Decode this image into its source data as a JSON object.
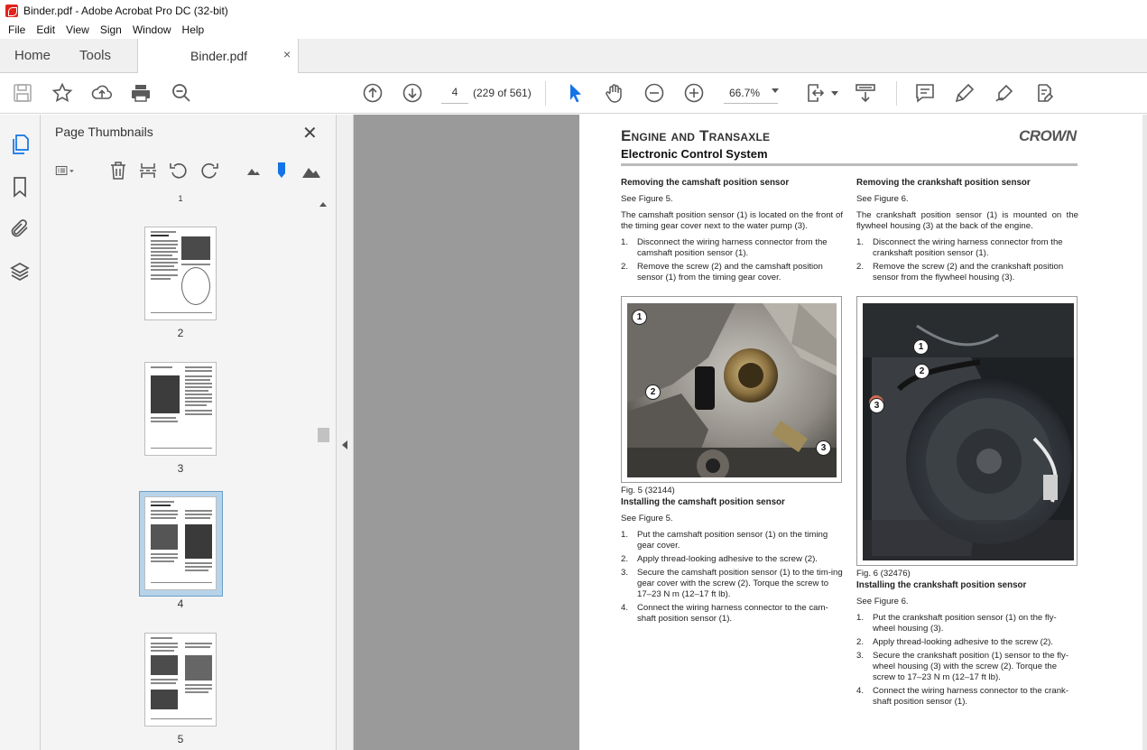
{
  "window": {
    "title": "Binder.pdf - Adobe Acrobat Pro DC (32-bit)"
  },
  "menu": [
    "File",
    "Edit",
    "View",
    "Sign",
    "Window",
    "Help"
  ],
  "tabs": {
    "home": "Home",
    "tools": "Tools",
    "document": "Binder.pdf",
    "close_glyph": "×"
  },
  "toolbar": {
    "current_page": "4",
    "page_count": "(229 of 561)",
    "zoom": "66.7%",
    "icons": [
      "save-icon",
      "bookmark-star-icon",
      "share-upload-icon",
      "print-icon",
      "find-icon",
      "previous-page-icon",
      "next-page-icon",
      "select-cursor-icon",
      "hand-icon",
      "zoom-out-icon",
      "zoom-in-icon",
      "page-fit-icon",
      "scroll-mode-icon",
      "comment-icon",
      "highlight-icon",
      "sign-icon",
      "fill-sign-icon"
    ]
  },
  "thumbnails_panel": {
    "title": "Page Thumbnails",
    "close_glyph": "✕",
    "top_partial_label": "1",
    "pages": [
      {
        "label": "2",
        "selected": false
      },
      {
        "label": "3",
        "selected": false
      },
      {
        "label": "4",
        "selected": true
      },
      {
        "label": "5",
        "selected": false
      }
    ]
  },
  "document_page": {
    "header": "Engine and Transaxle",
    "subheader": "Electronic Control System",
    "brand": "CROWN",
    "left": {
      "remove_heading": "Removing the camshaft position sensor",
      "remove_see": "See Figure 5.",
      "remove_intro": "The camshaft position sensor (1) is located on the front of the timing gear cover next to the water pump (3).",
      "remove_steps": [
        "Disconnect the wiring harness connector from the camshaft position sensor (1).",
        "Remove the screw (2) and the camshaft position sensor (1) from the timing gear cover."
      ],
      "figure_caption": "Fig. 5 (32144)",
      "install_heading": "Installing the camshaft position sensor",
      "install_see": "See Figure 5.",
      "install_steps": [
        "Put the camshaft position sensor (1) on the timing gear cover.",
        "Apply thread-looking adhesive to the screw (2).",
        "Secure the camshaft position sensor (1) to the tim-ing gear cover with the screw (2). Torque the screw to 17–23 N m (12–17 ft lb).",
        "Connect the wiring harness connector to the cam-shaft position sensor (1)."
      ]
    },
    "right": {
      "remove_heading": "Removing the crankshaft position sensor",
      "remove_see": "See Figure 6.",
      "remove_intro": "The crankshaft position sensor (1) is mounted on the flywheel housing (3) at the back of the engine.",
      "remove_steps": [
        "Disconnect the wiring harness connector from the crankshaft position sensor (1).",
        "Remove the screw (2) and the crankshaft position sensor from the flywheel housing (3)."
      ],
      "figure_caption": "Fig. 6 (32476)",
      "install_heading": "Installing the crankshaft position sensor",
      "install_see": "See Figure 6.",
      "install_steps": [
        "Put the crankshaft position sensor (1) on the fly-wheel housing (3).",
        "Apply thread-looking adhesive to the screw (2).",
        "Secure the crankshaft position (1) sensor to the fly-wheel housing (3) with the screw (2). Torque the screw to 17–23 N m (12–17 ft lb).",
        "Connect the wiring harness connector to the crank-shaft position sensor (1)."
      ]
    },
    "step_numbers": [
      "1.",
      "2.",
      "3.",
      "4."
    ],
    "callouts": [
      "1",
      "2",
      "3"
    ]
  },
  "colors": {
    "acrobat_red": "#e2231a",
    "selected_thumb": "#b6d3ea",
    "doc_background": "#9a9a9a",
    "active_tool_blue": "#1473e6"
  }
}
